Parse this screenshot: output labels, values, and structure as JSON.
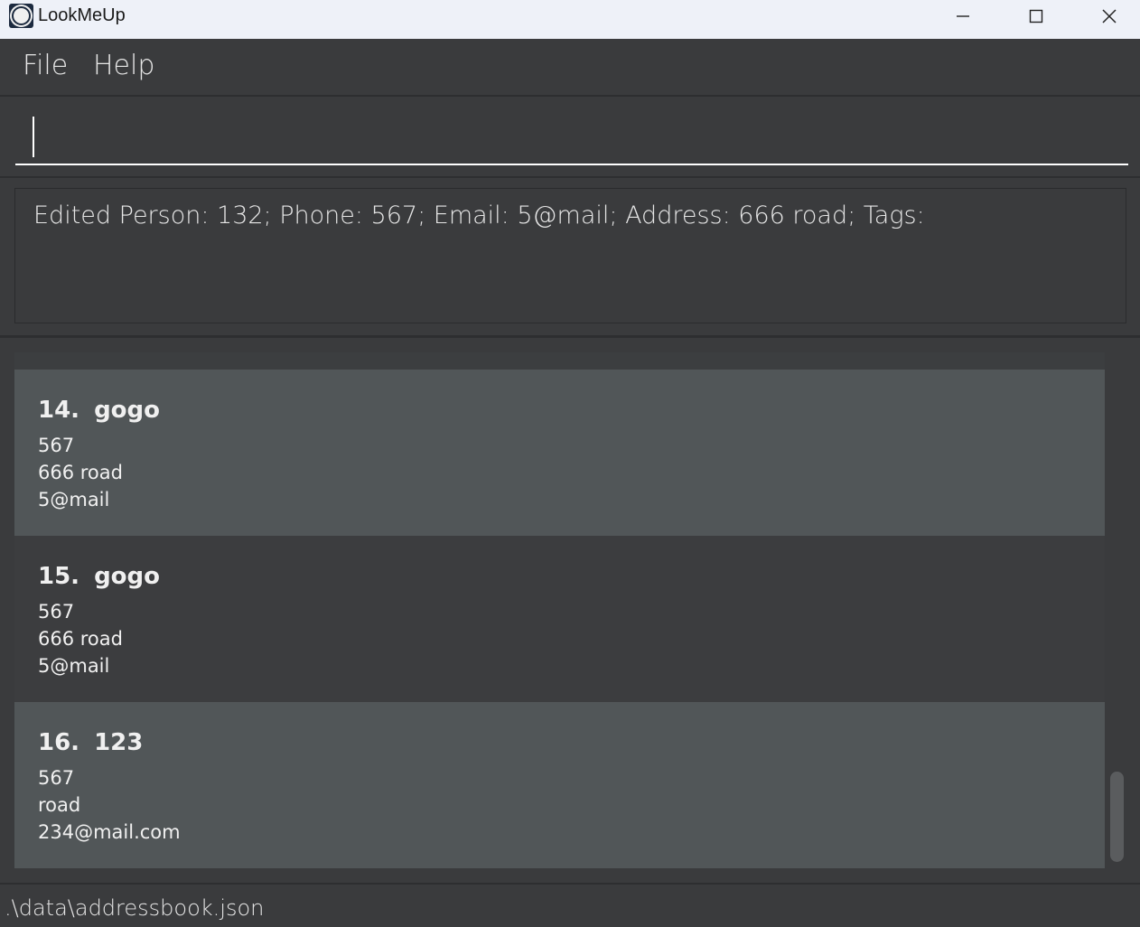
{
  "window": {
    "title": "LookMeUp",
    "icon": "app-logo-icon",
    "controls": {
      "minimize_icon": "minimize-icon",
      "maximize_icon": "maximize-icon",
      "close_icon": "close-icon"
    }
  },
  "menu": {
    "items": [
      {
        "label": "File"
      },
      {
        "label": "Help"
      }
    ]
  },
  "command": {
    "value": "",
    "placeholder": ""
  },
  "result": {
    "message": "Edited Person: 132; Phone: 567; Email: 5@mail; Address: 666 road; Tags:"
  },
  "persons": [
    {
      "index": "14.",
      "name": "gogo",
      "phone": "567",
      "address": "666 road",
      "email": "5@mail"
    },
    {
      "index": "15.",
      "name": "gogo",
      "phone": "567",
      "address": "666 road",
      "email": "5@mail"
    },
    {
      "index": "16.",
      "name": "123",
      "phone": "567",
      "address": "road",
      "email": "234@mail.com"
    }
  ],
  "status": {
    "file_path": ".\\data\\addressbook.json"
  },
  "colors": {
    "background": "#3a3b3d",
    "card_odd": "#515658",
    "card_even": "#3c3d3f",
    "titlebar": "#eef1f8"
  }
}
